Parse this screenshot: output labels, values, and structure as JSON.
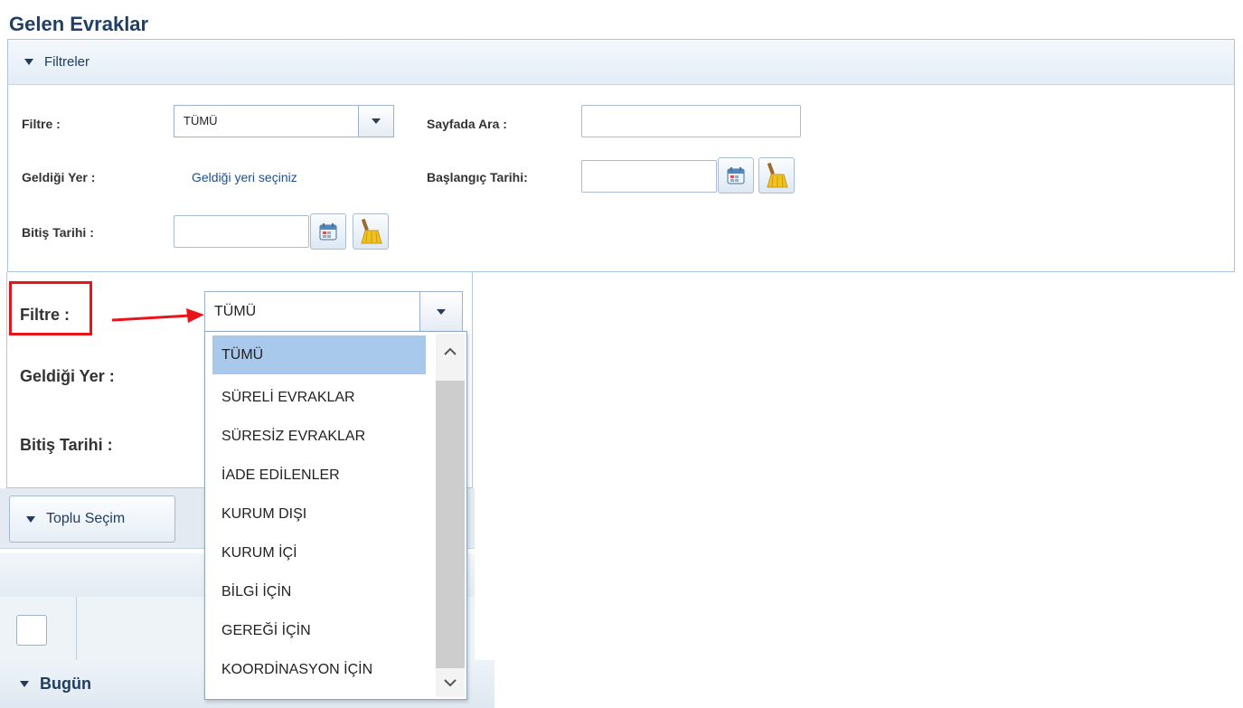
{
  "page": {
    "title": "Gelen Evraklar"
  },
  "filters_panel": {
    "header": "Filtreler",
    "filtre_label": "Filtre :",
    "filtre_value": "TÜMÜ",
    "sayfada_ara_label": "Sayfada Ara :",
    "sayfada_ara_value": "",
    "geldigi_yer_label": "Geldiği Yer :",
    "geldigi_yer_link": "Geldiği yeri seçiniz",
    "baslangic_label": "Başlangıç Tarihi:",
    "baslangic_value": "",
    "bitis_label": "Bitiş Tarihi :",
    "bitis_value": ""
  },
  "zoom": {
    "filtre_label": "Filtre :",
    "filtre_value": "TÜMÜ",
    "geldigi_yer_label": "Geldiği Yer :",
    "bitis_label": "Bitiş Tarihi :"
  },
  "dropdown": {
    "items": [
      "TÜMÜ",
      "SÜRELİ EVRAKLAR",
      "SÜRESİZ EVRAKLAR",
      "İADE EDİLENLER",
      "KURUM DIŞI",
      "KURUM İÇİ",
      "BİLGİ İÇİN",
      "GEREĞİ İÇİN",
      "KOORDİNASYON İÇİN"
    ],
    "selected": "TÜMÜ"
  },
  "toolbar": {
    "toplu_secim": "Toplu Seçim"
  },
  "groups": {
    "bugun": "Bugün"
  },
  "colors": {
    "highlight_red": "#e8141a",
    "selected_item": "#a8c8ec",
    "header_blue": "#1f3f66"
  },
  "icons": [
    "calendar-icon",
    "broom-icon",
    "chevron-down-icon",
    "scroll-up-icon",
    "scroll-down-icon"
  ]
}
